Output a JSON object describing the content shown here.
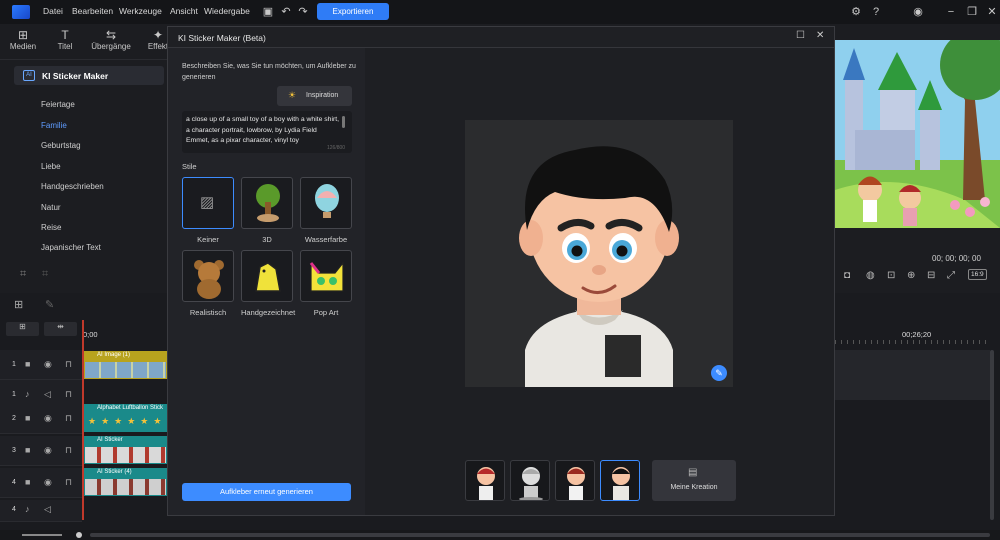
{
  "menu": [
    "Datei",
    "Bearbeiten",
    "Werkzeuge",
    "Ansicht",
    "Wiedergabe"
  ],
  "export_label": "Exportieren",
  "tabs": [
    "Medien",
    "Titel",
    "Übergänge",
    "Effekt"
  ],
  "category_header": "KI Sticker Maker",
  "categories": [
    "Feiertage",
    "Familie",
    "Geburtstag",
    "Liebe",
    "Handgeschrieben",
    "Natur",
    "Reise",
    "Japanischer Text"
  ],
  "dialog": {
    "title": "KI Sticker Maker (Beta)",
    "prompt_hint": "Beschreiben Sie, was Sie tun möchten, um Aufkleber zu generieren",
    "inspiration": "Inspiration",
    "prompt_text": "a close up of a small toy of a boy with a white shirt, a character portrait, lowbrow, by Lydia Field Emmet, as a pixar character, vinyl toy",
    "char_count": "126/800",
    "styles_label": "Stile",
    "styles": [
      "Keiner",
      "3D",
      "Wasserfarbe",
      "Realistisch",
      "Handgezeichnet",
      "Pop Art"
    ],
    "regenerate": "Aufkleber erneut generieren",
    "my_creation": "Meine Kreation"
  },
  "preview_timecode": "00; 00; 00; 00",
  "ratio": "16:9",
  "ruler_start": "0;00",
  "ruler_mark": "00;26;20",
  "clips": [
    "AI Image (1)",
    "Alphabet Luftballon Stick",
    "AI Sticker",
    "AI Sticker (4)"
  ],
  "track_numbers": [
    "1",
    "1",
    "2",
    "3",
    "4",
    "4"
  ],
  "colors": {
    "accent": "#2f7cf6",
    "clip_yellow": "#b8a31e",
    "clip_teal": "#1a8a8a"
  }
}
